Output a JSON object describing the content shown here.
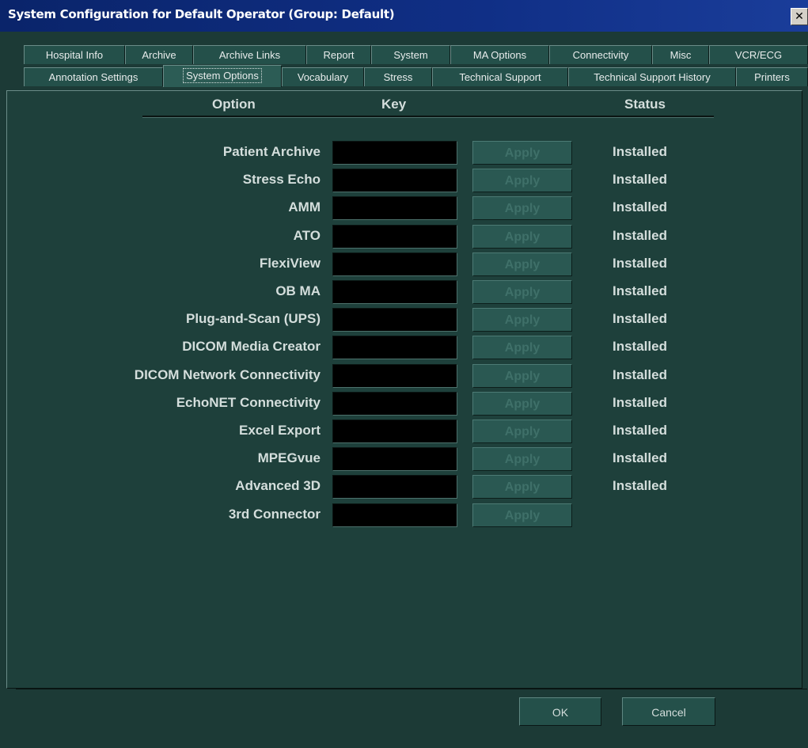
{
  "window": {
    "title": "System Configuration for Default Operator (Group: Default)",
    "close": "✕"
  },
  "tabs_row1": [
    "Hospital Info",
    "Archive",
    "Archive Links",
    "Report",
    "System",
    "MA Options",
    "Connectivity",
    "Misc",
    "VCR/ECG"
  ],
  "tabs_row2": [
    "Annotation Settings",
    "System Options",
    "Vocabulary",
    "Stress",
    "Technical Support",
    "Technical Support History",
    "Printers"
  ],
  "active_tab": "System Options",
  "columns": {
    "option": "Option",
    "key": "Key",
    "status": "Status"
  },
  "apply_label": "Apply",
  "options": [
    {
      "label": "Patient Archive",
      "status": "Installed"
    },
    {
      "label": "Stress Echo",
      "status": "Installed"
    },
    {
      "label": "AMM",
      "status": "Installed"
    },
    {
      "label": "ATO",
      "status": "Installed"
    },
    {
      "label": "FlexiView",
      "status": "Installed"
    },
    {
      "label": "OB MA",
      "status": "Installed"
    },
    {
      "label": "Plug-and-Scan (UPS)",
      "status": "Installed"
    },
    {
      "label": "DICOM Media Creator",
      "status": "Installed"
    },
    {
      "label": "DICOM Network Connectivity",
      "status": "Installed"
    },
    {
      "label": "EchoNET Connectivity",
      "status": "Installed"
    },
    {
      "label": "Excel Export",
      "status": "Installed"
    },
    {
      "label": "MPEGvue",
      "status": "Installed"
    },
    {
      "label": "Advanced 3D",
      "status": "Installed"
    },
    {
      "label": "3rd Connector",
      "status": ""
    }
  ],
  "buttons": {
    "ok": "OK",
    "cancel": "Cancel"
  }
}
